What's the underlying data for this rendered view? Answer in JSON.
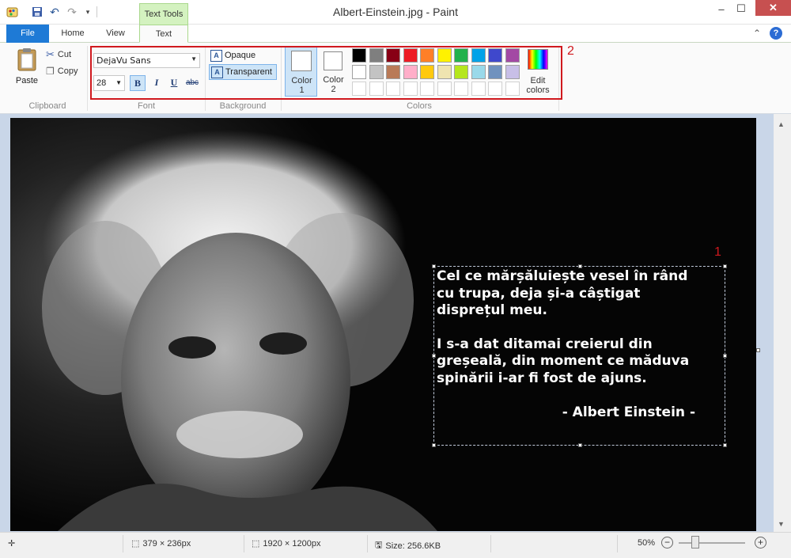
{
  "window": {
    "title": "Albert-Einstein.jpg - Paint",
    "context_tab": "Text Tools",
    "minimize": "–",
    "maximize": "☐",
    "close": "✕"
  },
  "tabs": [
    {
      "label": "File"
    },
    {
      "label": "Home"
    },
    {
      "label": "View"
    },
    {
      "label": "Text"
    }
  ],
  "ribbon": {
    "clipboard": {
      "paste": "Paste",
      "cut": "Cut",
      "copy": "Copy",
      "group": "Clipboard"
    },
    "font": {
      "family": "DejaVu Sans",
      "size": "28",
      "bold": "B",
      "italic": "I",
      "underline": "U",
      "strikethrough": "abc",
      "group": "Font"
    },
    "background": {
      "opaque": "Opaque",
      "transparent": "Transparent",
      "group": "Background"
    },
    "colors": {
      "color1": "Color 1",
      "color2": "Color 2",
      "edit": "Edit colors",
      "group": "Colors",
      "palette_row1": [
        "#000000",
        "#7f7f7f",
        "#880015",
        "#ed1c24",
        "#ff7f27",
        "#fff200",
        "#22b14c",
        "#00a2e8",
        "#3f48cc",
        "#a349a4"
      ],
      "palette_row2": [
        "#ffffff",
        "#c3c3c3",
        "#b97a57",
        "#ffaec9",
        "#ffc90e",
        "#efe4b0",
        "#b5e61d",
        "#99d9ea",
        "#7092be",
        "#c8bfe7"
      ],
      "palette_row3": [
        "#ffffff",
        "#ffffff",
        "#ffffff",
        "#ffffff",
        "#ffffff",
        "#ffffff",
        "#ffffff",
        "#ffffff",
        "#ffffff",
        "#ffffff"
      ]
    }
  },
  "annotations": {
    "box_number": "2",
    "text_number": "1"
  },
  "canvas_text": {
    "line1": "Cel ce mărșăluiește vesel în rând\ncu trupa, deja și-a câștigat\ndisprețul meu.",
    "line2": "I s-a dat ditamai creierul din\ngreșeală, din moment ce măduva\nspinării i-ar fi fost de ajuns.",
    "author": "- Albert Einstein -"
  },
  "status": {
    "selection_size": "379 × 236px",
    "image_size": "1920 × 1200px",
    "file_size": "Size: 256.6KB",
    "zoom": "50%",
    "zoom_fraction": 0.5
  }
}
